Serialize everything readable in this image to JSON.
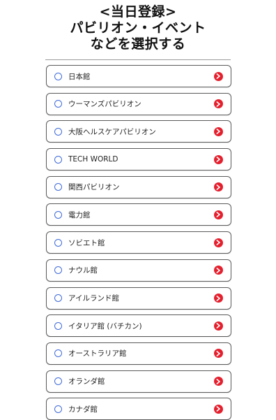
{
  "header": {
    "line1": "<当日登録>",
    "line2": "パビリオン・イベント",
    "line3": "などを選択する"
  },
  "colors": {
    "accent_red": "#e5202e",
    "radio_blue": "#3f6ad8"
  },
  "icons": {
    "radio": "radio-circle-icon",
    "chevron": "chevron-right-icon"
  },
  "items": [
    {
      "label": "日本館"
    },
    {
      "label": "ウーマンズパビリオン"
    },
    {
      "label": "大阪ヘルスケアパビリオン"
    },
    {
      "label": "TECH WORLD"
    },
    {
      "label": "関西パビリオン"
    },
    {
      "label": "電力館"
    },
    {
      "label": "ソビエト館"
    },
    {
      "label": "ナウル館"
    },
    {
      "label": "アイルランド館"
    },
    {
      "label": "イタリア館 (バチカン)"
    },
    {
      "label": "オーストラリア館"
    },
    {
      "label": "オランダ館"
    },
    {
      "label": "カナダ館"
    }
  ]
}
